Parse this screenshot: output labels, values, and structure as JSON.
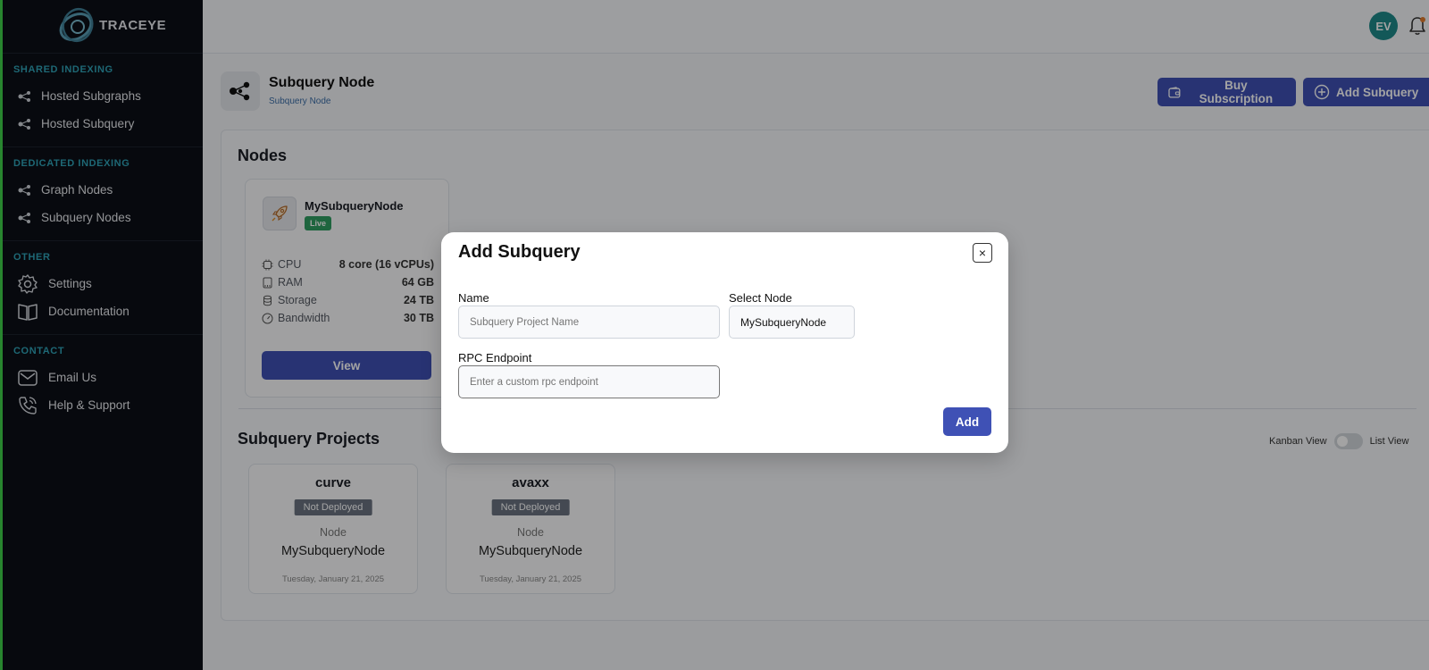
{
  "brand": {
    "name": "TRACEYE"
  },
  "sidebar": {
    "sections": [
      {
        "title": "SHARED INDEXING",
        "items": [
          {
            "label": "Hosted Subgraphs",
            "icon": "nodes-icon"
          },
          {
            "label": "Hosted Subquery",
            "icon": "nodes-icon"
          }
        ]
      },
      {
        "title": "DEDICATED INDEXING",
        "items": [
          {
            "label": "Graph Nodes",
            "icon": "nodes-icon"
          },
          {
            "label": "Subquery Nodes",
            "icon": "nodes-icon"
          }
        ]
      },
      {
        "title": "OTHER",
        "items": [
          {
            "label": "Settings",
            "icon": "gear-icon"
          },
          {
            "label": "Documentation",
            "icon": "book-icon"
          }
        ]
      },
      {
        "title": "CONTACT",
        "items": [
          {
            "label": "Email Us",
            "icon": "mail-icon"
          },
          {
            "label": "Help & Support",
            "icon": "phone-icon"
          }
        ]
      }
    ]
  },
  "topbar": {
    "avatar_initials": "EV"
  },
  "header": {
    "title": "Subquery Node",
    "breadcrumb": "Subquery Node",
    "buy_label": "Buy Subscription",
    "add_label": "Add Subquery"
  },
  "nodes": {
    "title": "Nodes",
    "card": {
      "name": "MySubqueryNode",
      "status": "Live",
      "specs": [
        {
          "label": "CPU",
          "value": "8 core (16 vCPUs)"
        },
        {
          "label": "RAM",
          "value": "64 GB"
        },
        {
          "label": "Storage",
          "value": "24 TB"
        },
        {
          "label": "Bandwidth",
          "value": "30 TB"
        }
      ],
      "view_label": "View"
    }
  },
  "projects": {
    "title": "Subquery Projects",
    "kanban_label": "Kanban View",
    "list_label": "List View",
    "items": [
      {
        "name": "curve",
        "status": "Not Deployed",
        "node_label": "Node",
        "node": "MySubqueryNode",
        "date": "Tuesday, January 21, 2025"
      },
      {
        "name": "avaxx",
        "status": "Not Deployed",
        "node_label": "Node",
        "node": "MySubqueryNode",
        "date": "Tuesday, January 21, 2025"
      }
    ]
  },
  "modal": {
    "title": "Add Subquery",
    "close_label": "×",
    "name_label": "Name",
    "name_placeholder": "Subquery Project Name",
    "node_label": "Select Node",
    "node_value": "MySubqueryNode",
    "rpc_label": "RPC Endpoint",
    "rpc_placeholder": "Enter a custom rpc endpoint",
    "add_label": "Add"
  },
  "colors": {
    "accent": "#3f51b5",
    "sidebar": "#0b0f16",
    "section_title": "#2fa3b8",
    "live": "#2f9e62"
  }
}
